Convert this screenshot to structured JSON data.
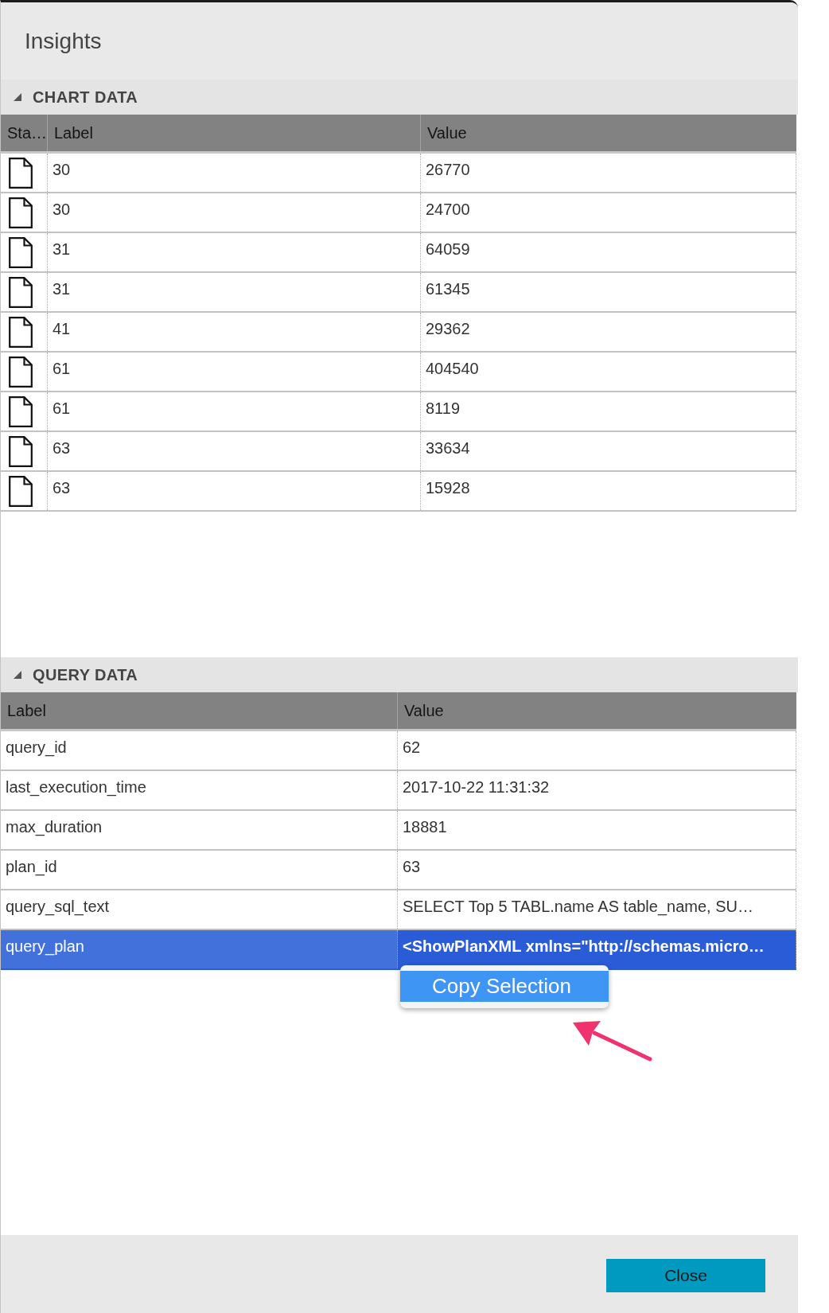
{
  "window": {
    "title": "Insights"
  },
  "panels": [
    {
      "kind": "document-list",
      "title": "CHART DATA",
      "expanded": true,
      "columns": [
        "Sta…",
        "Label",
        "Value"
      ],
      "rows": [
        {
          "label": "30",
          "value": "26770",
          "selected": false
        },
        {
          "label": "30",
          "value": "24700",
          "selected": false
        },
        {
          "label": "31",
          "value": "64059",
          "selected": false
        },
        {
          "label": "31",
          "value": "61345",
          "selected": false
        },
        {
          "label": "41",
          "value": "29362",
          "selected": false
        },
        {
          "label": "61",
          "value": "404540",
          "selected": false
        },
        {
          "label": "61",
          "value": "8119",
          "selected": false
        },
        {
          "label": "63",
          "value": "33634",
          "selected": false
        },
        {
          "label": "63",
          "value": "15928",
          "selected": false
        }
      ]
    },
    {
      "kind": "property-list",
      "title": "QUERY DATA",
      "expanded": true,
      "columns": [
        "Label",
        "Value"
      ],
      "rows": [
        {
          "label": "query_id",
          "value": "62",
          "selected": false
        },
        {
          "label": "last_execution_time",
          "value": "2017-10-22 11:31:32",
          "selected": false
        },
        {
          "label": "max_duration",
          "value": "18881",
          "selected": false
        },
        {
          "label": "plan_id",
          "value": "63",
          "selected": false
        },
        {
          "label": "query_sql_text",
          "value": "SELECT Top 5 TABL.name AS table_name, SU…",
          "selected": false
        },
        {
          "label": "query_plan",
          "value": "<ShowPlanXML xmlns=\"http://schemas.micro…",
          "selected": true
        }
      ],
      "context_menu": {
        "items": [
          {
            "label": "Copy Selection",
            "selected": true
          }
        ]
      }
    }
  ],
  "footer": {
    "buttons": [
      "Close"
    ]
  }
}
